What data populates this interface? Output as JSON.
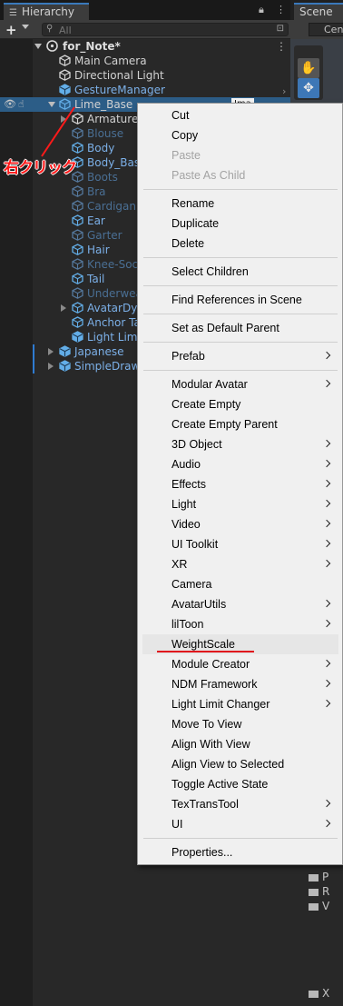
{
  "hierarchy": {
    "tab_label": "Hierarchy",
    "search_placeholder": "All",
    "scene_root": "for_Note*",
    "items": [
      {
        "label": "Main Camera",
        "style": "normal"
      },
      {
        "label": "Directional Light",
        "style": "normal"
      },
      {
        "label": "GestureManager",
        "style": "prefab"
      },
      {
        "label": "Lime_Base",
        "style": "selected"
      },
      {
        "label": "Armature",
        "style": "normal"
      },
      {
        "label": "Blouse",
        "style": "prefab-dim"
      },
      {
        "label": "Body",
        "style": "prefab"
      },
      {
        "label": "Body_Base",
        "style": "prefab"
      },
      {
        "label": "Boots",
        "style": "prefab-dim"
      },
      {
        "label": "Bra",
        "style": "prefab-dim"
      },
      {
        "label": "Cardigan",
        "style": "prefab-dim"
      },
      {
        "label": "Ear",
        "style": "prefab"
      },
      {
        "label": "Garter",
        "style": "prefab-dim"
      },
      {
        "label": "Hair",
        "style": "prefab"
      },
      {
        "label": "Knee-Socks",
        "style": "prefab-dim"
      },
      {
        "label": "Tail",
        "style": "prefab"
      },
      {
        "label": "Underwear",
        "style": "prefab-dim"
      },
      {
        "label": "AvatarDynamics",
        "style": "prefab"
      },
      {
        "label": "Anchor Target",
        "style": "prefab"
      },
      {
        "label": "Light Limit Changer",
        "style": "prefab"
      },
      {
        "label": "Japanese",
        "style": "prefab"
      },
      {
        "label": "SimpleDraw",
        "style": "prefab"
      }
    ],
    "selected_badge": "Ima"
  },
  "annotation": {
    "right_click_text": "右クリック",
    "color": "#ff1a1a"
  },
  "scene": {
    "tab_label": "Scene",
    "dropdown_label": "Center",
    "project_rows": [
      "P",
      "R",
      "V",
      "X"
    ]
  },
  "context_menu": {
    "items": [
      {
        "label": "Cut"
      },
      {
        "label": "Copy"
      },
      {
        "label": "Paste",
        "disabled": true
      },
      {
        "label": "Paste As Child",
        "disabled": true
      },
      {
        "sep": true
      },
      {
        "label": "Rename"
      },
      {
        "label": "Duplicate"
      },
      {
        "label": "Delete"
      },
      {
        "sep": true
      },
      {
        "label": "Select Children"
      },
      {
        "sep": true
      },
      {
        "label": "Find References in Scene"
      },
      {
        "sep": true
      },
      {
        "label": "Set as Default Parent"
      },
      {
        "sep": true
      },
      {
        "label": "Prefab",
        "submenu": true
      },
      {
        "sep": true
      },
      {
        "label": "Modular Avatar",
        "submenu": true
      },
      {
        "label": "Create Empty"
      },
      {
        "label": "Create Empty Parent"
      },
      {
        "label": "3D Object",
        "submenu": true
      },
      {
        "label": "Audio",
        "submenu": true
      },
      {
        "label": "Effects",
        "submenu": true
      },
      {
        "label": "Light",
        "submenu": true
      },
      {
        "label": "Video",
        "submenu": true
      },
      {
        "label": "UI Toolkit",
        "submenu": true
      },
      {
        "label": "XR",
        "submenu": true
      },
      {
        "label": "Camera"
      },
      {
        "label": "AvatarUtils",
        "submenu": true
      },
      {
        "label": "lilToon",
        "submenu": true
      },
      {
        "label": "WeightScale",
        "highlighted": true
      },
      {
        "label": "Module Creator",
        "submenu": true
      },
      {
        "label": "NDM Framework",
        "submenu": true
      },
      {
        "label": "Light Limit Changer",
        "submenu": true
      },
      {
        "label": "Move To View"
      },
      {
        "label": "Align With View"
      },
      {
        "label": "Align View to Selected"
      },
      {
        "label": "Toggle Active State"
      },
      {
        "label": "TexTransTool",
        "submenu": true
      },
      {
        "label": "UI",
        "submenu": true
      },
      {
        "sep": true
      },
      {
        "label": "Properties..."
      }
    ]
  }
}
